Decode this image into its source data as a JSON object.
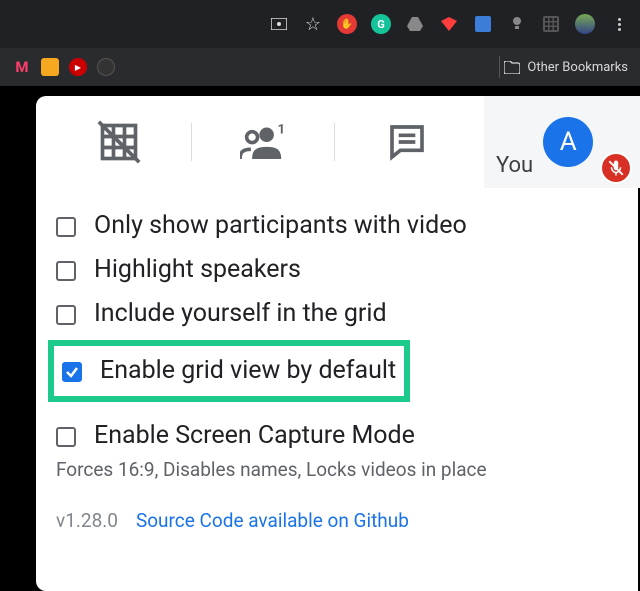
{
  "browser": {
    "other_bookmarks_label": "Other Bookmarks"
  },
  "panel": {
    "you_label": "You",
    "avatar_initial": "A",
    "options": {
      "only_video": {
        "label": "Only show participants with video",
        "checked": false
      },
      "highlight_speakers": {
        "label": "Highlight speakers",
        "checked": false
      },
      "include_self": {
        "label": "Include yourself in the grid",
        "checked": false
      },
      "enable_default": {
        "label": "Enable grid view by default",
        "checked": true
      },
      "screen_capture": {
        "label": "Enable Screen Capture Mode",
        "checked": false
      },
      "screen_capture_desc": "Forces 16:9, Disables names, Locks videos in place"
    },
    "footer": {
      "version": "v1.28.0",
      "source_link": "Source Code available on Github"
    }
  }
}
